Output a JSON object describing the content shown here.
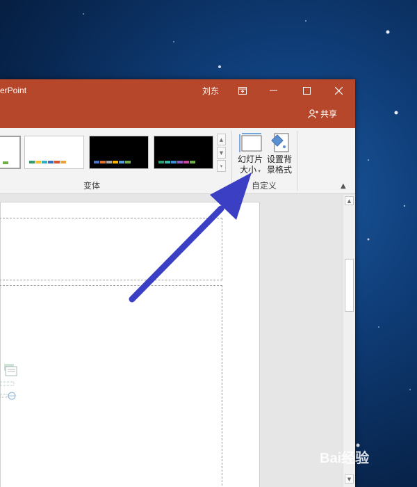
{
  "window": {
    "app_title": "erPoint",
    "user_name": "刘东",
    "share_label": "共享"
  },
  "ribbon": {
    "variants_group_label": "变体",
    "customize_group_label": "自定义",
    "slide_size_label_line1": "幻灯片",
    "slide_size_label_line2": "大小",
    "format_bg_label_line1": "设置背",
    "format_bg_label_line2": "景格式"
  },
  "colors": {
    "title_bar": "#b7472a",
    "annotation_arrow": "#3b3fc4"
  },
  "icons": [
    "restore-ribbon-icon",
    "minimize-icon",
    "maximize-icon",
    "close-icon",
    "share-icon",
    "slide-size-icon",
    "format-background-icon",
    "collapse-ribbon-icon"
  ],
  "watermark": {
    "text": "Bai经验"
  }
}
